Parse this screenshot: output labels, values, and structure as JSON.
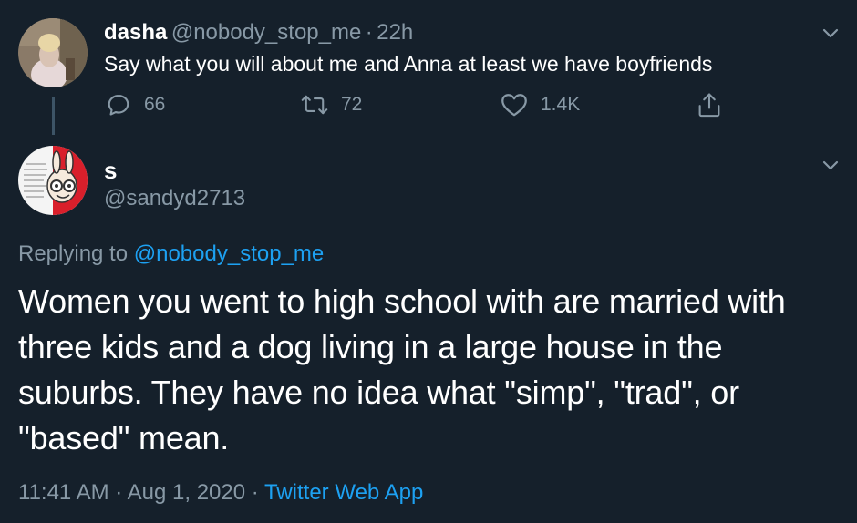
{
  "parent_tweet": {
    "display_name": "dasha",
    "handle": "@nobody_stop_me",
    "separator": "·",
    "time": "22h",
    "text": "Say what you will about me and Anna at least we have boyfriends",
    "actions": {
      "reply_count": "66",
      "retweet_count": "72",
      "like_count": "1.4K"
    }
  },
  "reply_tweet": {
    "display_name": "s",
    "handle": "@sandyd2713",
    "replying_prefix": "Replying to",
    "replying_to": "@nobody_stop_me",
    "text": "Women you went to high school with are married with three kids and a dog living in a large house in the suburbs. They have no idea what \"simp\", \"trad\", or \"based\" mean.",
    "time": "11:41 AM",
    "sep1": "·",
    "date": "Aug 1, 2020",
    "sep2": "·",
    "source": "Twitter Web App"
  },
  "colors": {
    "background": "#15202b",
    "primary_text": "#ffffff",
    "secondary_text": "#8899a6",
    "link": "#1da1f2",
    "thread_line": "#3d5466"
  },
  "icons": [
    "reply-icon",
    "retweet-icon",
    "like-icon",
    "share-icon",
    "chevron-down-icon"
  ]
}
